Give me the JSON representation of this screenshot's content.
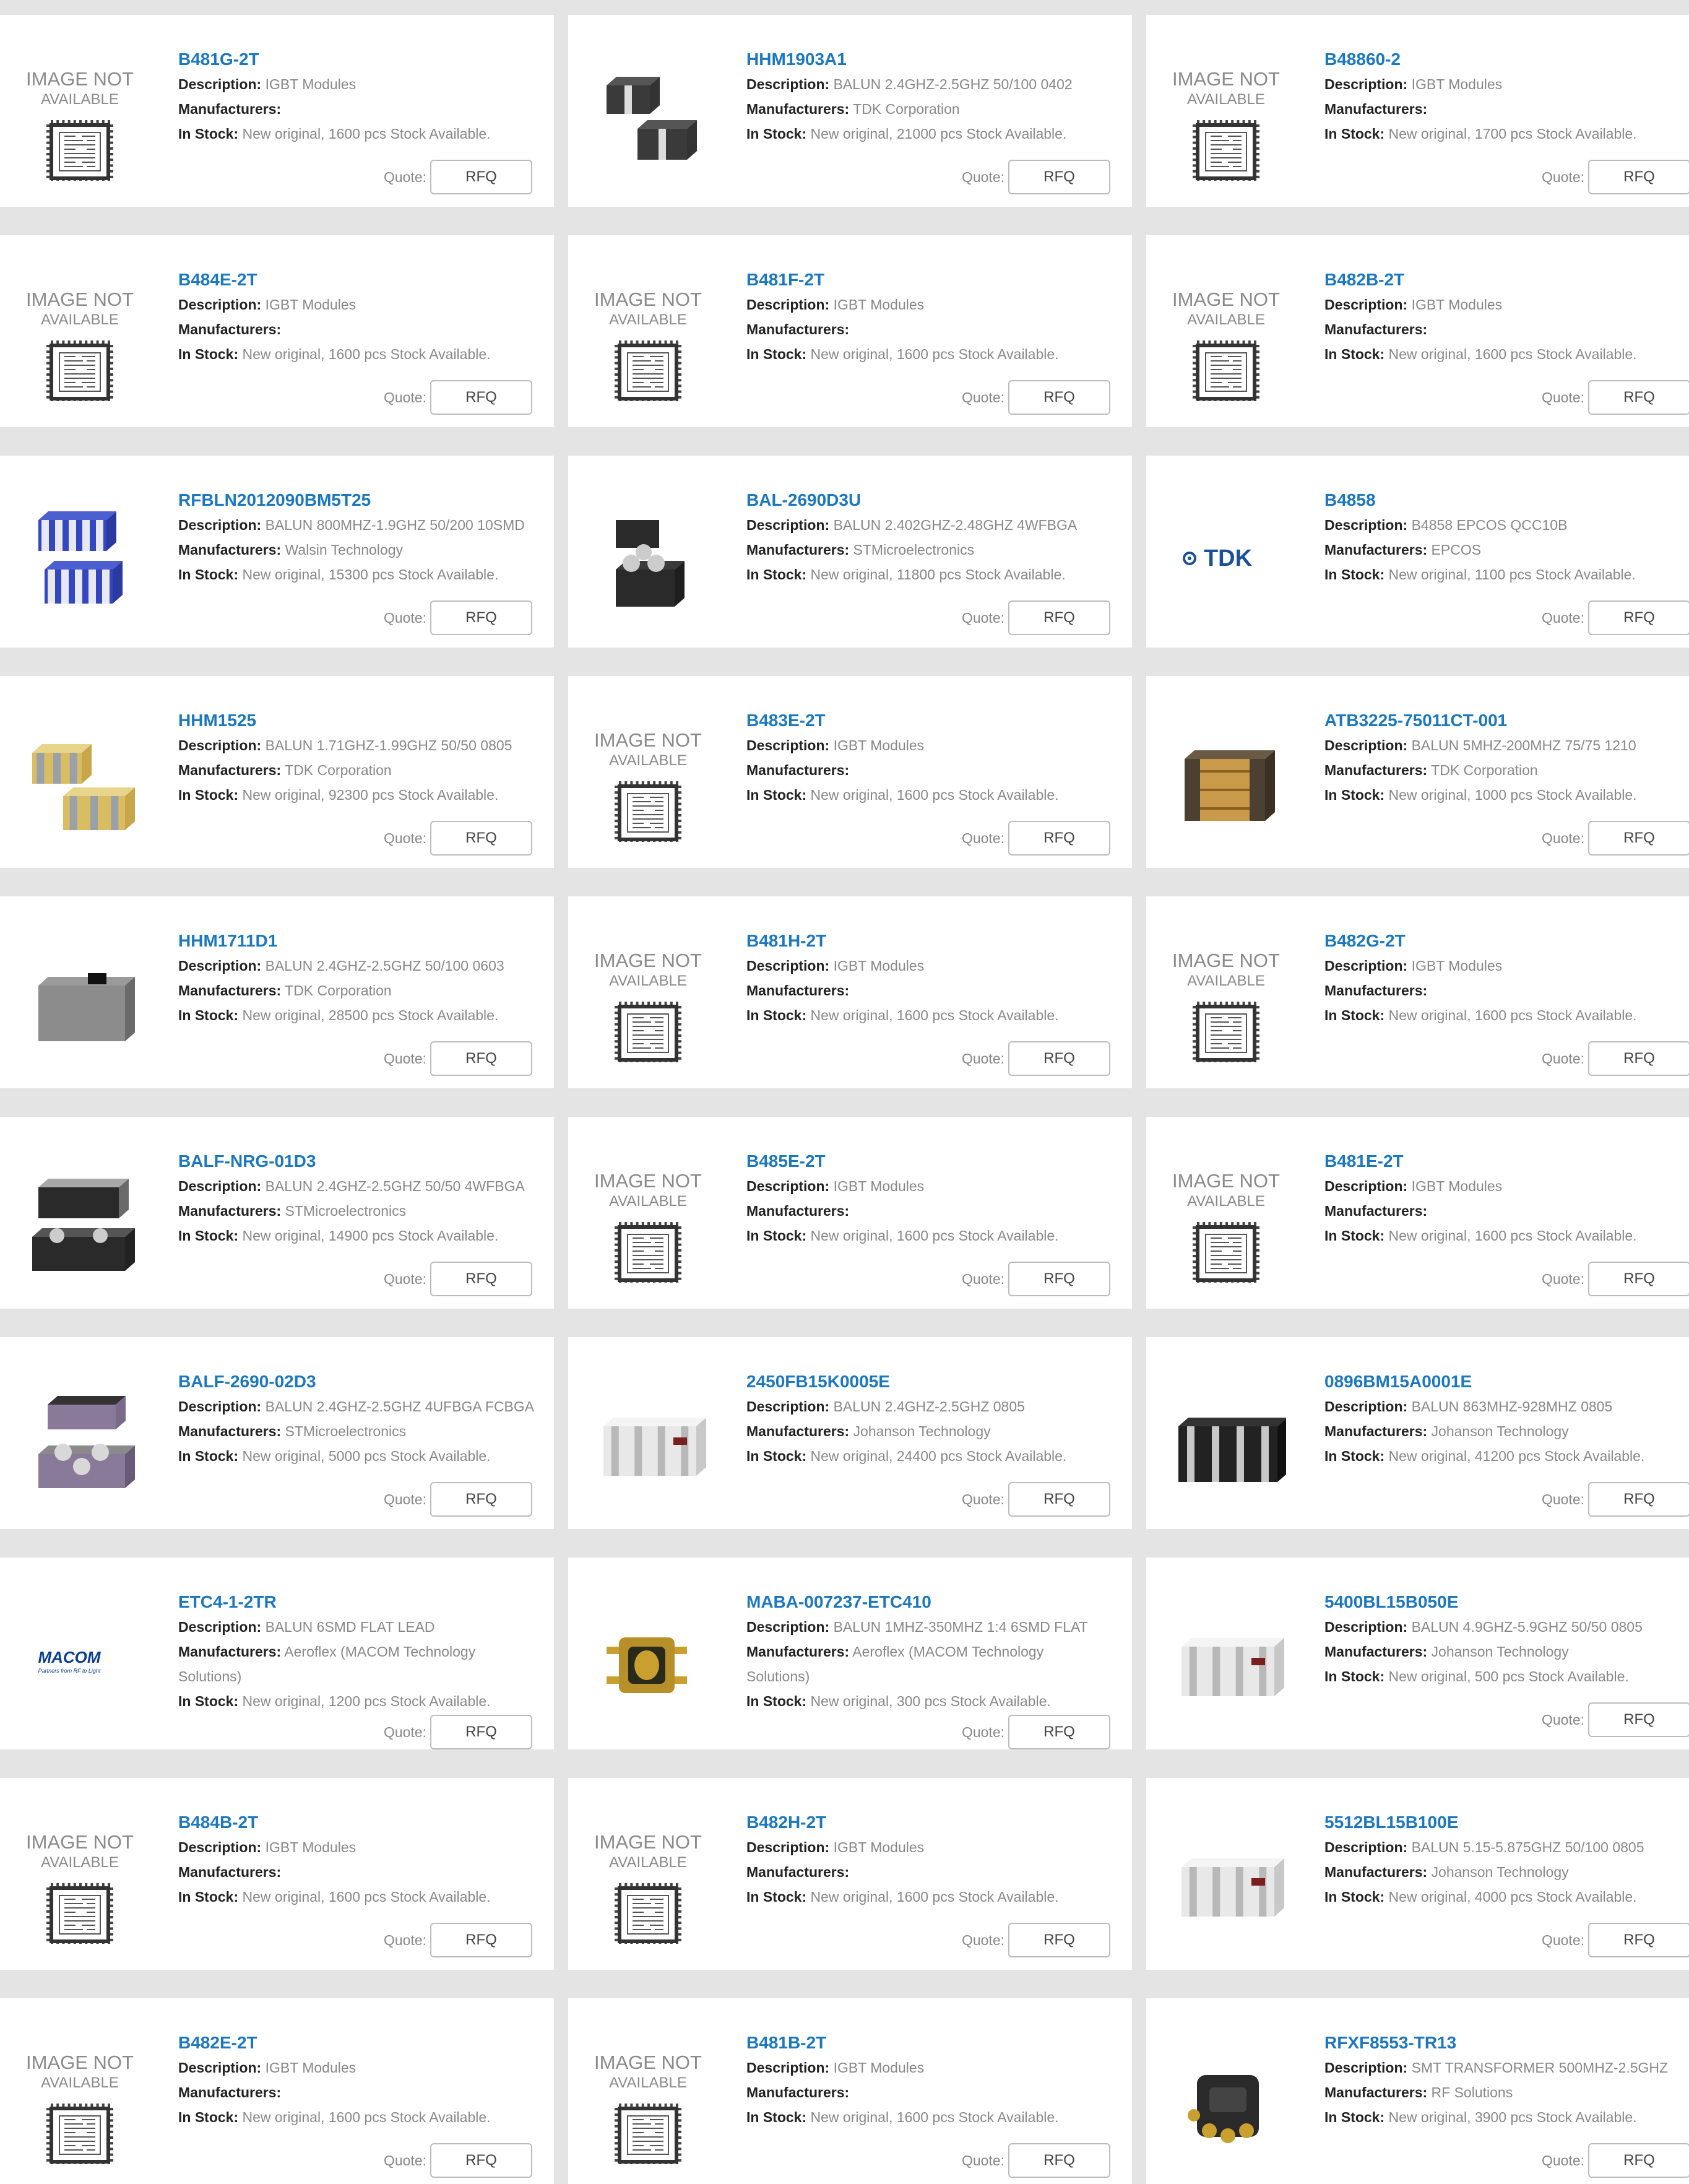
{
  "labels": {
    "description": "Description:",
    "manufacturers": "Manufacturers:",
    "in_stock": "In Stock:",
    "quote": "Quote:",
    "rfq": "RFQ",
    "image_not": "IMAGE NOT",
    "available": "AVAILABLE",
    "tdk_logo": "TDK",
    "macom_logo": "MACOM",
    "macom_tagline": "Partners from RF to Light"
  },
  "products": [
    {
      "part": "B481G-2T",
      "description": "IGBT Modules",
      "manufacturer": "",
      "stock": "New original, 1600 pcs Stock Available.",
      "image": "image-not-available"
    },
    {
      "part": "HHM1903A1",
      "description": "BALUN 2.4GHZ-2.5GHZ 50/100 0402",
      "manufacturer": "TDK Corporation",
      "stock": "New original, 21000 pcs Stock Available.",
      "image": "chip-dark-pair"
    },
    {
      "part": "B48860-2",
      "description": "IGBT Modules",
      "manufacturer": "",
      "stock": "New original, 1700 pcs Stock Available.",
      "image": "image-not-available"
    },
    {
      "part": "B484E-2T",
      "description": "IGBT Modules",
      "manufacturer": "",
      "stock": "New original, 1600 pcs Stock Available.",
      "image": "image-not-available"
    },
    {
      "part": "B481F-2T",
      "description": "IGBT Modules",
      "manufacturer": "",
      "stock": "New original, 1600 pcs Stock Available.",
      "image": "image-not-available"
    },
    {
      "part": "B482B-2T",
      "description": "IGBT Modules",
      "manufacturer": "",
      "stock": "New original, 1600 pcs Stock Available.",
      "image": "image-not-available"
    },
    {
      "part": "RFBLN2012090BM5T25",
      "description": "BALUN 800MHZ-1.9GHZ 50/200 10SMD",
      "manufacturer": "Walsin Technology",
      "stock": "New original, 15300 pcs Stock Available.",
      "image": "chip-blue-pair"
    },
    {
      "part": "BAL-2690D3U",
      "description": "BALUN 2.402GHZ-2.48GHZ 4WFBGA",
      "manufacturer": "STMicroelectronics",
      "stock": "New original, 11800 pcs Stock Available.",
      "image": "chip-bga-dark"
    },
    {
      "part": "B4858",
      "description": "B4858 EPCOS QCC10B",
      "manufacturer": "EPCOS",
      "stock": "New original, 1100 pcs Stock Available.",
      "image": "tdk-logo"
    },
    {
      "part": "HHM1525",
      "description": "BALUN 1.71GHZ-1.99GHZ 50/50 0805",
      "manufacturer": "TDK Corporation",
      "stock": "New original, 92300 pcs Stock Available.",
      "image": "chip-yellow-pair"
    },
    {
      "part": "B483E-2T",
      "description": "IGBT Modules",
      "manufacturer": "",
      "stock": "New original, 1600 pcs Stock Available.",
      "image": "image-not-available"
    },
    {
      "part": "ATB3225-75011CT-001",
      "description": "BALUN 5MHZ-200MHZ 75/75 1210",
      "manufacturer": "TDK Corporation",
      "stock": "New original, 1000 pcs Stock Available.",
      "image": "chip-coil"
    },
    {
      "part": "HHM1711D1",
      "description": "BALUN 2.4GHZ-2.5GHZ 50/100 0603",
      "manufacturer": "TDK Corporation",
      "stock": "New original, 28500 pcs Stock Available.",
      "image": "chip-grey"
    },
    {
      "part": "B481H-2T",
      "description": "IGBT Modules",
      "manufacturer": "",
      "stock": "New original, 1600 pcs Stock Available.",
      "image": "image-not-available"
    },
    {
      "part": "B482G-2T",
      "description": "IGBT Modules",
      "manufacturer": "",
      "stock": "New original, 1600 pcs Stock Available.",
      "image": "image-not-available"
    },
    {
      "part": "BALF-NRG-01D3",
      "description": "BALUN 2.4GHZ-2.5GHZ 50/50 4WFBGA",
      "manufacturer": "STMicroelectronics",
      "stock": "New original, 14900 pcs Stock Available.",
      "image": "chip-bga-pair"
    },
    {
      "part": "B485E-2T",
      "description": "IGBT Modules",
      "manufacturer": "",
      "stock": "New original, 1600 pcs Stock Available.",
      "image": "image-not-available"
    },
    {
      "part": "B481E-2T",
      "description": "IGBT Modules",
      "manufacturer": "",
      "stock": "New original, 1600 pcs Stock Available.",
      "image": "image-not-available"
    },
    {
      "part": "BALF-2690-02D3",
      "description": "BALUN 2.4GHZ-2.5GHZ 4UFBGA FCBGA",
      "manufacturer": "STMicroelectronics",
      "stock": "New original, 5000 pcs Stock Available.",
      "image": "chip-purple-pair"
    },
    {
      "part": "2450FB15K0005E",
      "description": "BALUN 2.4GHZ-2.5GHZ 0805",
      "manufacturer": "Johanson Technology",
      "stock": "New original, 24400 pcs Stock Available.",
      "image": "chip-white"
    },
    {
      "part": "0896BM15A0001E",
      "description": "BALUN 863MHZ-928MHZ 0805",
      "manufacturer": "Johanson Technology",
      "stock": "New original, 41200 pcs Stock Available.",
      "image": "chip-black"
    },
    {
      "part": "ETC4-1-2TR",
      "description": "BALUN 6SMD FLAT LEAD",
      "manufacturer": "Aeroflex (MACOM Technology Solutions)",
      "stock": "New original, 1200 pcs Stock Available.",
      "image": "macom-logo"
    },
    {
      "part": "MABA-007237-ETC410",
      "description": "BALUN 1MHZ-350MHZ 1:4 6SMD FLAT",
      "manufacturer": "Aeroflex (MACOM Technology Solutions)",
      "stock": "New original, 300 pcs Stock Available.",
      "image": "chip-transformer"
    },
    {
      "part": "5400BL15B050E",
      "description": "BALUN 4.9GHZ-5.9GHZ 50/50 0805",
      "manufacturer": "Johanson Technology",
      "stock": "New original, 500 pcs Stock Available.",
      "image": "chip-white"
    },
    {
      "part": "B484B-2T",
      "description": "IGBT Modules",
      "manufacturer": "",
      "stock": "New original, 1600 pcs Stock Available.",
      "image": "image-not-available"
    },
    {
      "part": "B482H-2T",
      "description": "IGBT Modules",
      "manufacturer": "",
      "stock": "New original, 1600 pcs Stock Available.",
      "image": "image-not-available"
    },
    {
      "part": "5512BL15B100E",
      "description": "BALUN 5.15-5.875GHZ 50/100 0805",
      "manufacturer": "Johanson Technology",
      "stock": "New original, 4000 pcs Stock Available.",
      "image": "chip-white"
    },
    {
      "part": "B482E-2T",
      "description": "IGBT Modules",
      "manufacturer": "",
      "stock": "New original, 1600 pcs Stock Available.",
      "image": "image-not-available"
    },
    {
      "part": "B481B-2T",
      "description": "IGBT Modules",
      "manufacturer": "",
      "stock": "New original, 1600 pcs Stock Available.",
      "image": "image-not-available"
    },
    {
      "part": "RFXF8553-TR13",
      "description": "SMT TRANSFORMER 500MHZ-2.5GHZ",
      "manufacturer": "RF Solutions",
      "stock": "New original, 3900 pcs Stock Available.",
      "image": "chip-rfxf"
    }
  ]
}
